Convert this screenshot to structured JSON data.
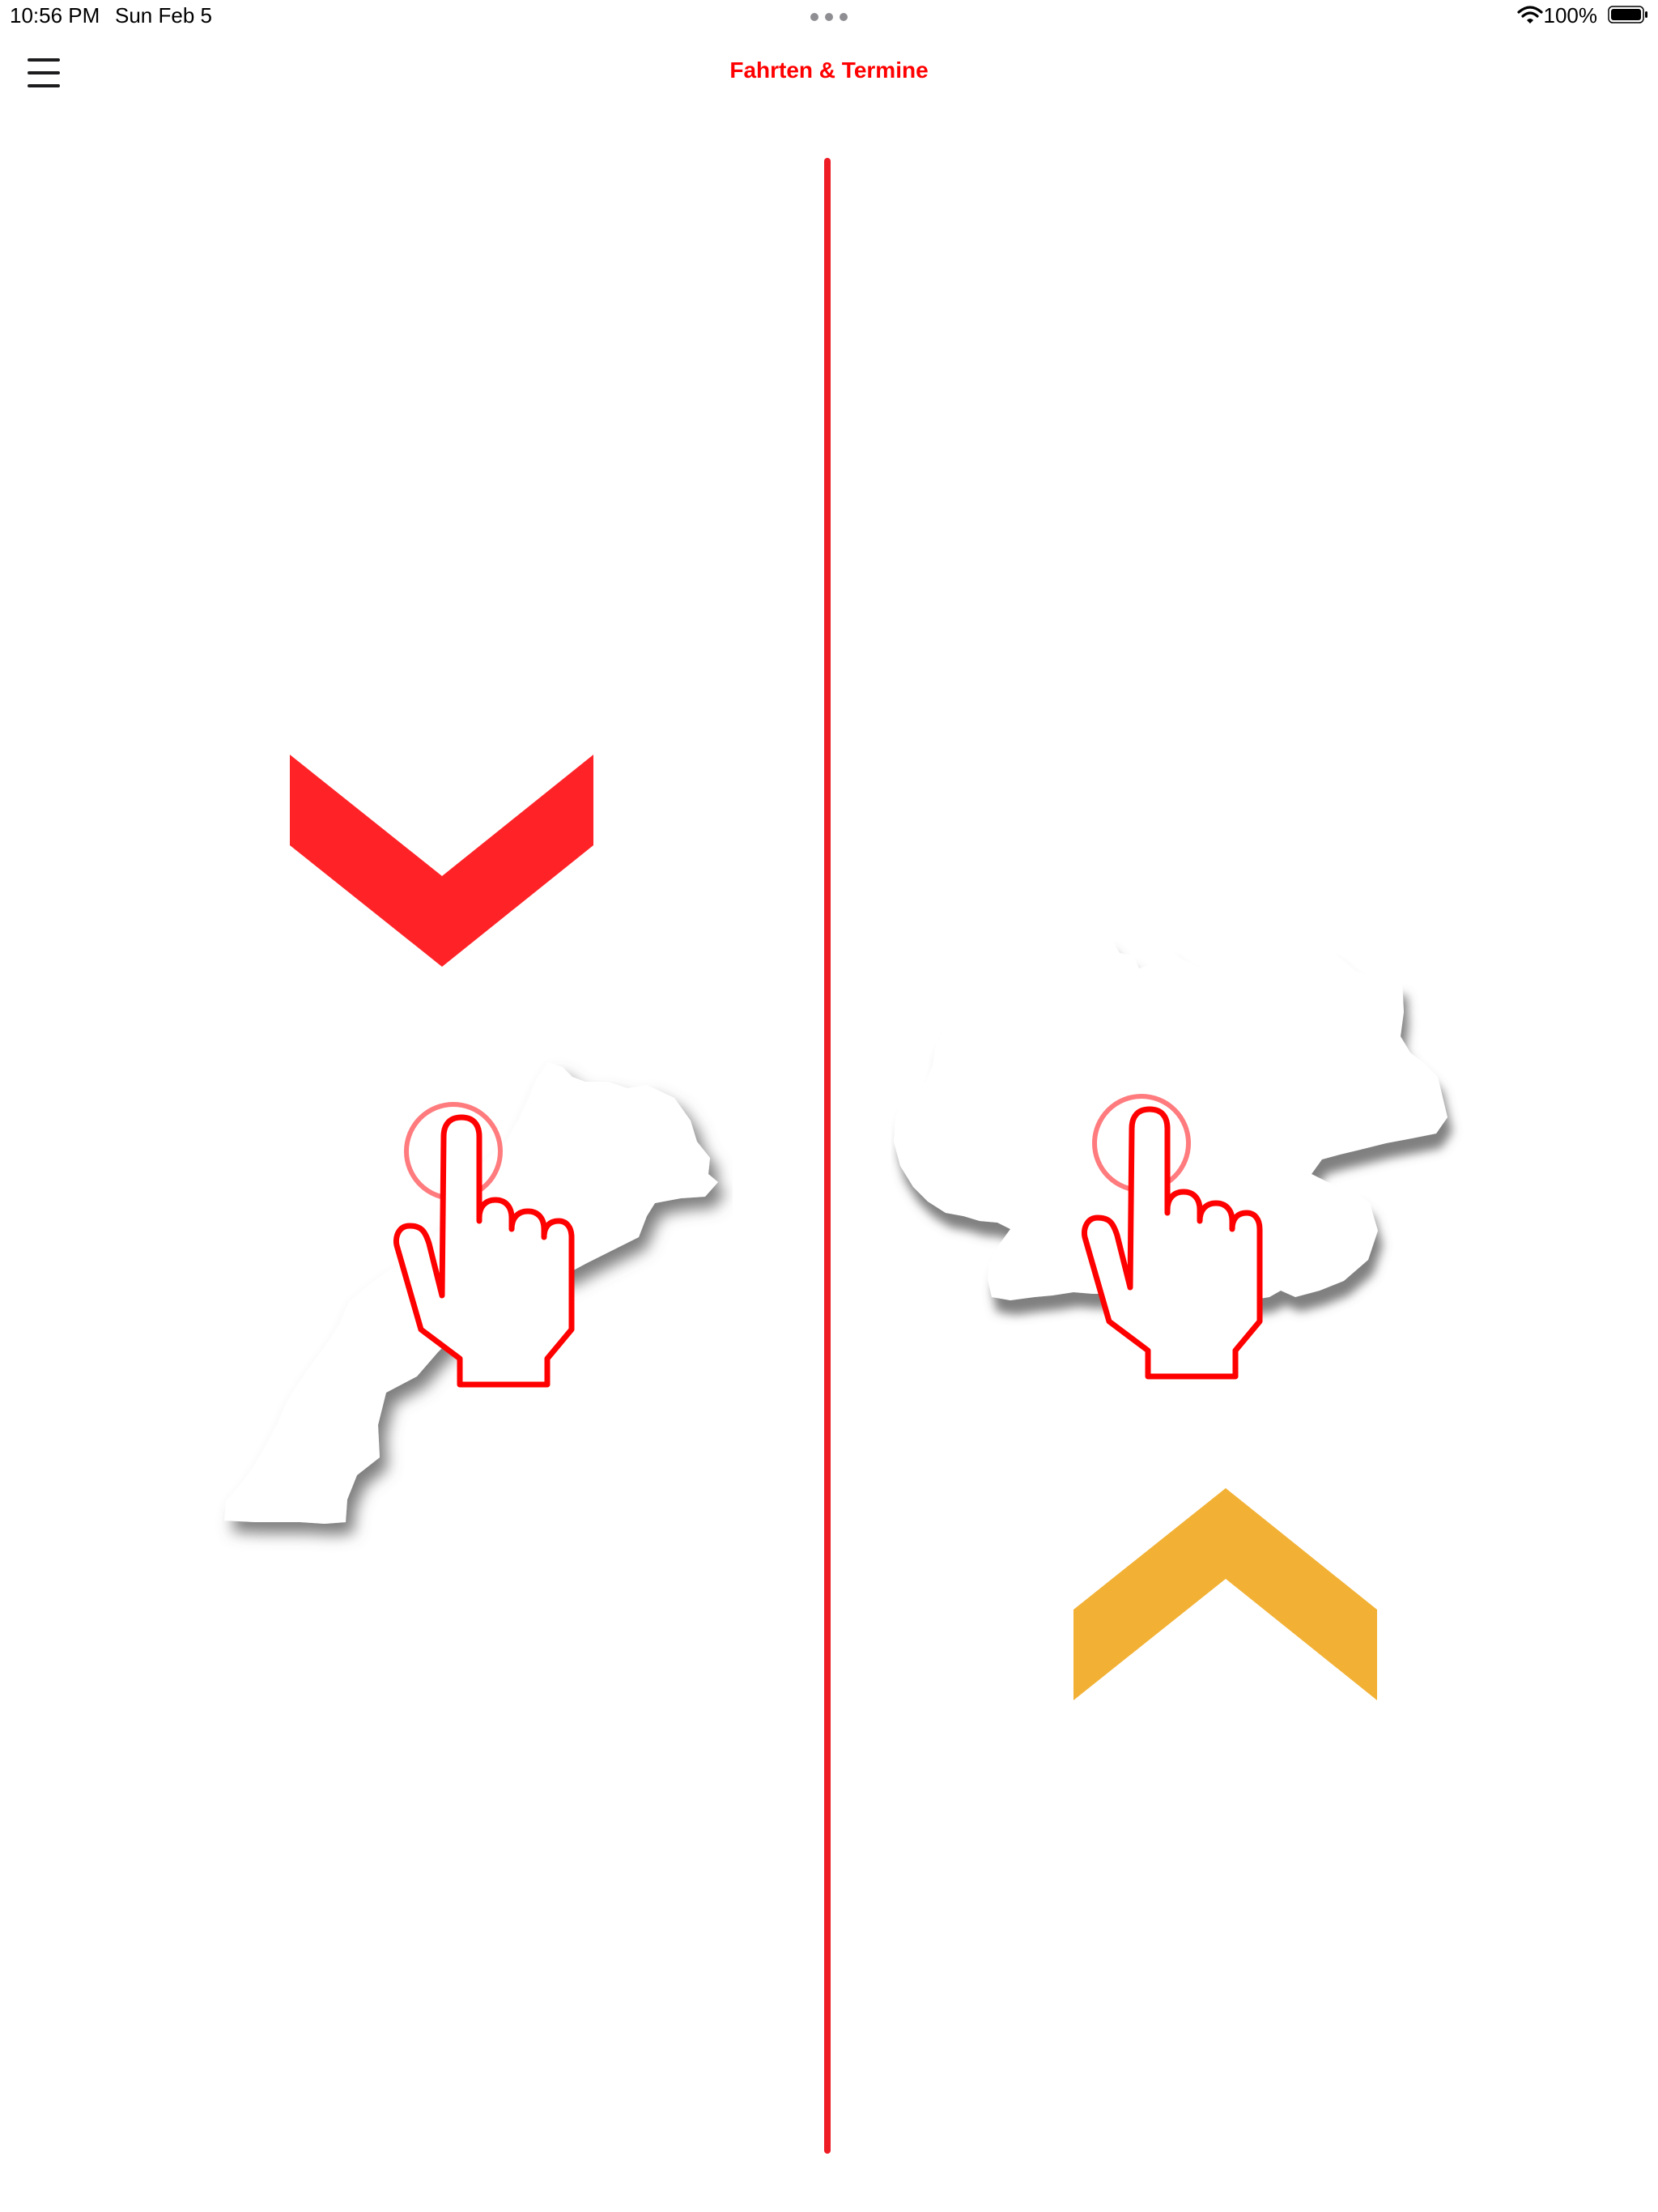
{
  "status_bar": {
    "time": "10:56 PM",
    "date": "Sun Feb 5",
    "battery_percent": "100%",
    "icons": [
      "multitasking-dots-icon",
      "wifi-icon",
      "battery-icon"
    ]
  },
  "nav": {
    "title": "Fahrten & Termine",
    "menu_icon": "hamburger-menu-icon"
  },
  "colors": {
    "accent": "#ff0000",
    "divider": "#ee1c25",
    "left_chevron": "#ff2328",
    "right_chevron": "#f2b135",
    "map_fill": "#ffffff",
    "map_shadow": "#7d7d7d"
  },
  "panels": [
    {
      "id": "left",
      "map_icon": "morocco-map-icon",
      "chevron_icon": "chevron-down-icon",
      "gesture_icon": "tap-hand-icon"
    },
    {
      "id": "right",
      "map_icon": "germany-map-icon",
      "chevron_icon": "chevron-up-icon",
      "gesture_icon": "tap-hand-icon"
    }
  ]
}
